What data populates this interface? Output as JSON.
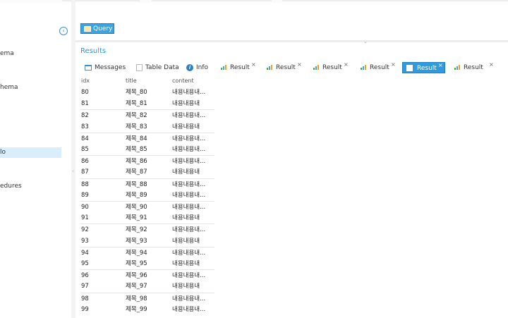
{
  "sidebar": {
    "items": [
      {
        "label": "ema"
      },
      {
        "label": "hema"
      },
      {
        "label": "lo",
        "selected": true
      },
      {
        "label": "edures"
      }
    ]
  },
  "toolbar": {
    "query_label": "Query"
  },
  "results": {
    "title": "Results",
    "tabs": [
      {
        "label": "Messages",
        "icon": "messages-icon",
        "closable": false
      },
      {
        "label": "Table Data",
        "icon": "table-icon",
        "closable": false
      },
      {
        "label": "Info",
        "icon": "info-icon",
        "closable": false
      },
      {
        "label": "Result",
        "icon": "result-chart-icon",
        "closable": true
      },
      {
        "label": "Result",
        "icon": "result-chart-icon",
        "closable": true
      },
      {
        "label": "Result",
        "icon": "result-chart-icon",
        "closable": true
      },
      {
        "label": "Result",
        "icon": "result-chart-icon",
        "closable": true
      },
      {
        "label": "Result",
        "icon": "result-chart-icon",
        "closable": true,
        "active": true
      },
      {
        "label": "Result",
        "icon": "result-chart-icon",
        "closable": true
      }
    ],
    "close_glyph": "×"
  },
  "table": {
    "columns": [
      "idx",
      "title",
      "content"
    ],
    "rows": [
      [
        "80",
        "제목_80",
        "내용내용내..."
      ],
      [
        "81",
        "제목_81",
        "내용내용내"
      ],
      [
        "82",
        "제목_82",
        "내용내용내..."
      ],
      [
        "83",
        "제목_83",
        "내용내용내"
      ],
      [
        "84",
        "제목_84",
        "내용내용내..."
      ],
      [
        "85",
        "제목_85",
        "내용내용내..."
      ],
      [
        "86",
        "제목_86",
        "내용내용내..."
      ],
      [
        "87",
        "제목_87",
        "내용내용내"
      ],
      [
        "88",
        "제목_88",
        "내용내용내..."
      ],
      [
        "89",
        "제목_89",
        "내용내용내..."
      ],
      [
        "90",
        "제목_90",
        "내용내용내..."
      ],
      [
        "91",
        "제목_91",
        "내용내용내"
      ],
      [
        "92",
        "제목_92",
        "내용내용내..."
      ],
      [
        "93",
        "제목_93",
        "내용내용내"
      ],
      [
        "94",
        "제목_94",
        "내용내용내..."
      ],
      [
        "95",
        "제목_95",
        "내용내용내"
      ],
      [
        "96",
        "제목_96",
        "내용내용내..."
      ],
      [
        "97",
        "제목_97",
        "내용내용내"
      ],
      [
        "98",
        "제목_98",
        "내용내용내..."
      ],
      [
        "99",
        "제목_99",
        "내용내용내..."
      ]
    ]
  },
  "colors": {
    "accent": "#2e9be0",
    "link": "#3a8fd0",
    "selected_bg": "#d8eefa"
  }
}
